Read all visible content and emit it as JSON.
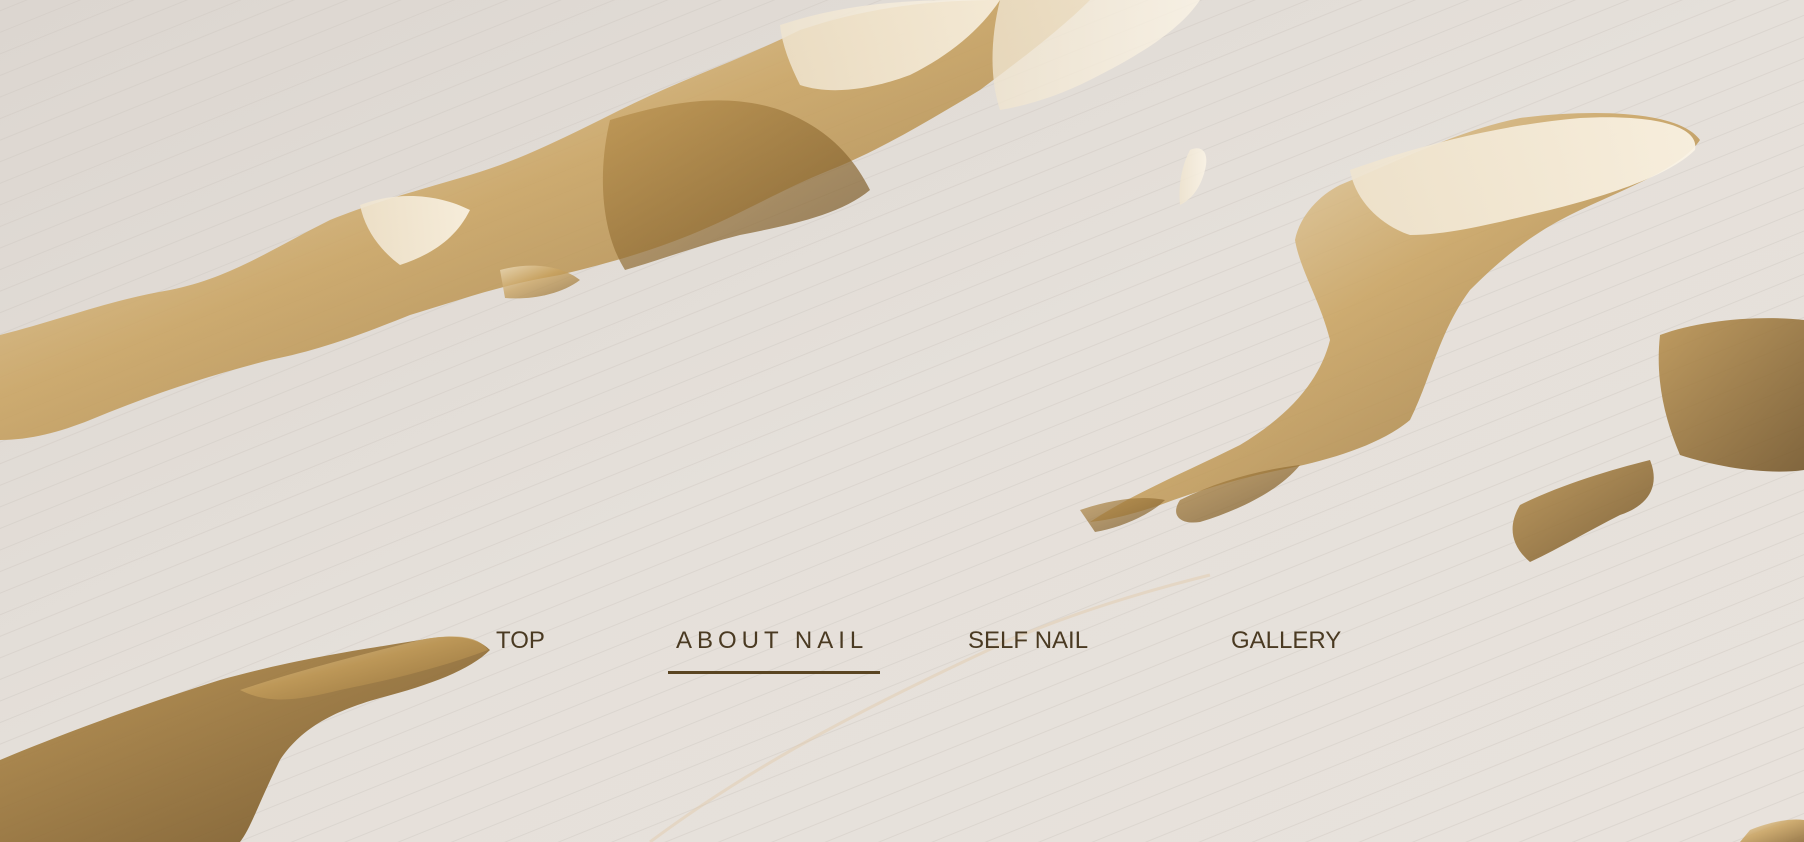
{
  "nav": {
    "items": [
      {
        "label": "TOP"
      },
      {
        "label": "ABOUT NAIL"
      },
      {
        "label": "SELF NAIL"
      },
      {
        "label": "GALLERY"
      }
    ],
    "active_label": "ABOUT NAIL"
  },
  "colors": {
    "background": "#e6e1dc",
    "gold": "#c7a15a",
    "nav_text": "#4a3a22",
    "underline": "#5a4522"
  },
  "hero": {
    "image": "plaster-texture-with-gold-leaf"
  }
}
